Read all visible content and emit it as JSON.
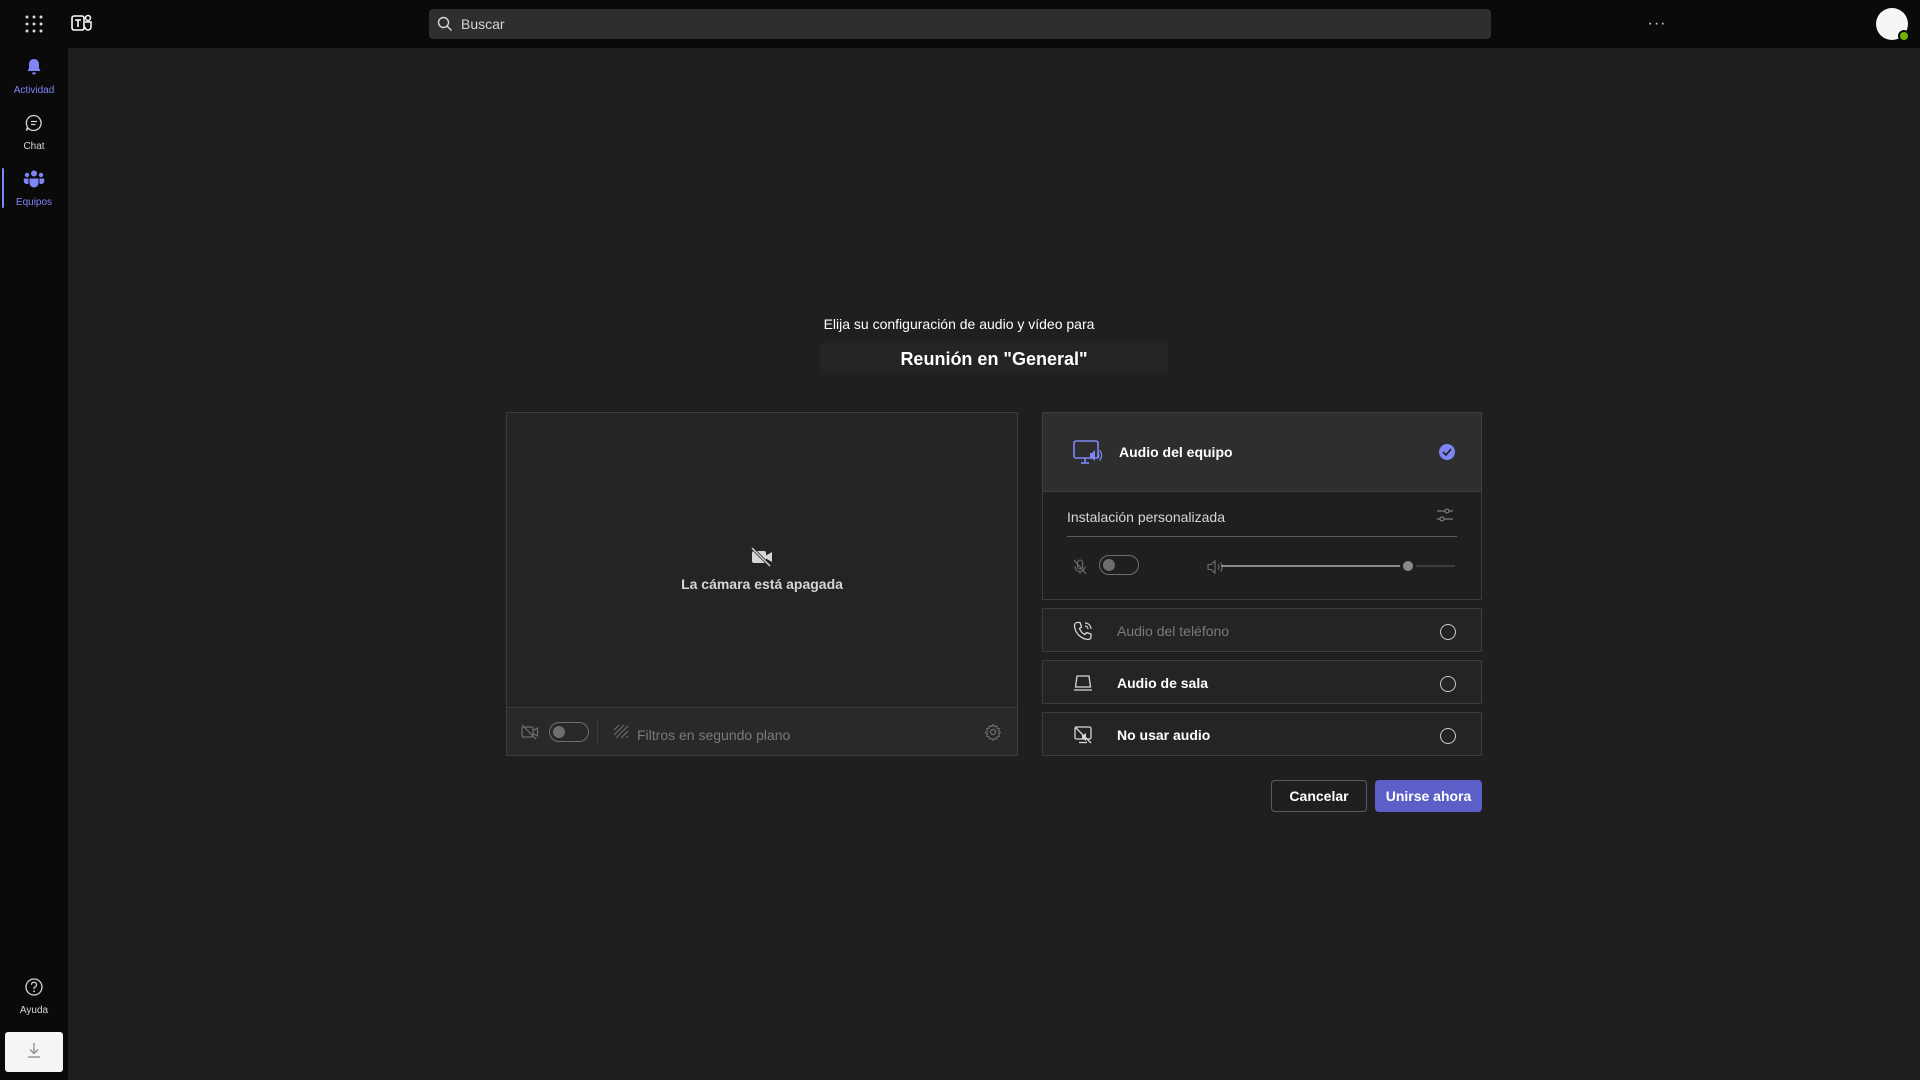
{
  "topbar": {
    "search_placeholder": "Buscar",
    "more_label": "···"
  },
  "rail": {
    "items": [
      {
        "label": "Actividad",
        "icon": "bell-icon",
        "active": true
      },
      {
        "label": "Chat",
        "icon": "chat-icon",
        "active": false
      },
      {
        "label": "Equipos",
        "icon": "teams-icon",
        "active": false
      }
    ],
    "help_label": "Ayuda"
  },
  "prejoin": {
    "heading": "Elija su configuración de audio y vídeo para",
    "meeting_title": "Reunión en \"General\"",
    "camera_off_text": "La cámara está apagada",
    "background_filters_label": "Filtros en segundo plano",
    "camera_toggle_on": false
  },
  "audio": {
    "computer_audio_label": "Audio del equipo",
    "computer_audio_selected": true,
    "custom_setup_label": "Instalación personalizada",
    "mic_toggle_on": false,
    "speaker_volume": 0.8,
    "options": [
      {
        "label": "Audio del teléfono",
        "icon": "phone-icon",
        "enabled": false
      },
      {
        "label": "Audio de sala",
        "icon": "room-device-icon",
        "enabled": true
      },
      {
        "label": "No usar audio",
        "icon": "no-audio-icon",
        "enabled": true
      }
    ]
  },
  "actions": {
    "cancel_label": "Cancelar",
    "join_label": "Unirse ahora"
  },
  "colors": {
    "accent": "#7f85f5",
    "primary_button": "#5b5fc7",
    "background": "#1f1f1f",
    "rail": "#0a0a0a"
  }
}
